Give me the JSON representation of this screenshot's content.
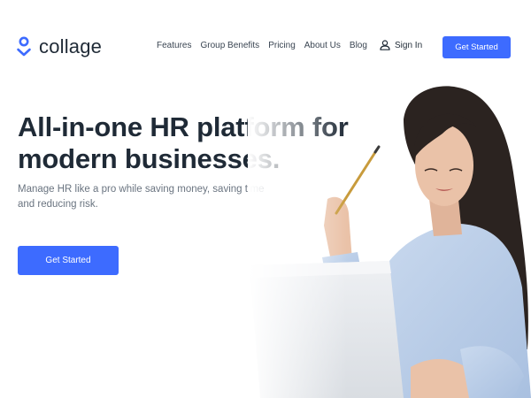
{
  "brand": {
    "name": "collage",
    "accent": "#3d6bff",
    "text_color": "#1f2a36"
  },
  "nav": {
    "items": [
      {
        "label": "Features"
      },
      {
        "label": "Group Benefits"
      },
      {
        "label": "Pricing"
      },
      {
        "label": "About Us"
      },
      {
        "label": "Blog"
      }
    ],
    "sign_in": {
      "label": "Sign In",
      "icon": "user-icon"
    },
    "cta": {
      "label": "Get Started"
    }
  },
  "hero": {
    "title_line1": "All-in-one HR platform for",
    "title_line2": "modern businesses.",
    "subtitle": "Manage HR like a pro while saving money, saving time and reducing risk.",
    "cta": {
      "label": "Get Started"
    }
  }
}
